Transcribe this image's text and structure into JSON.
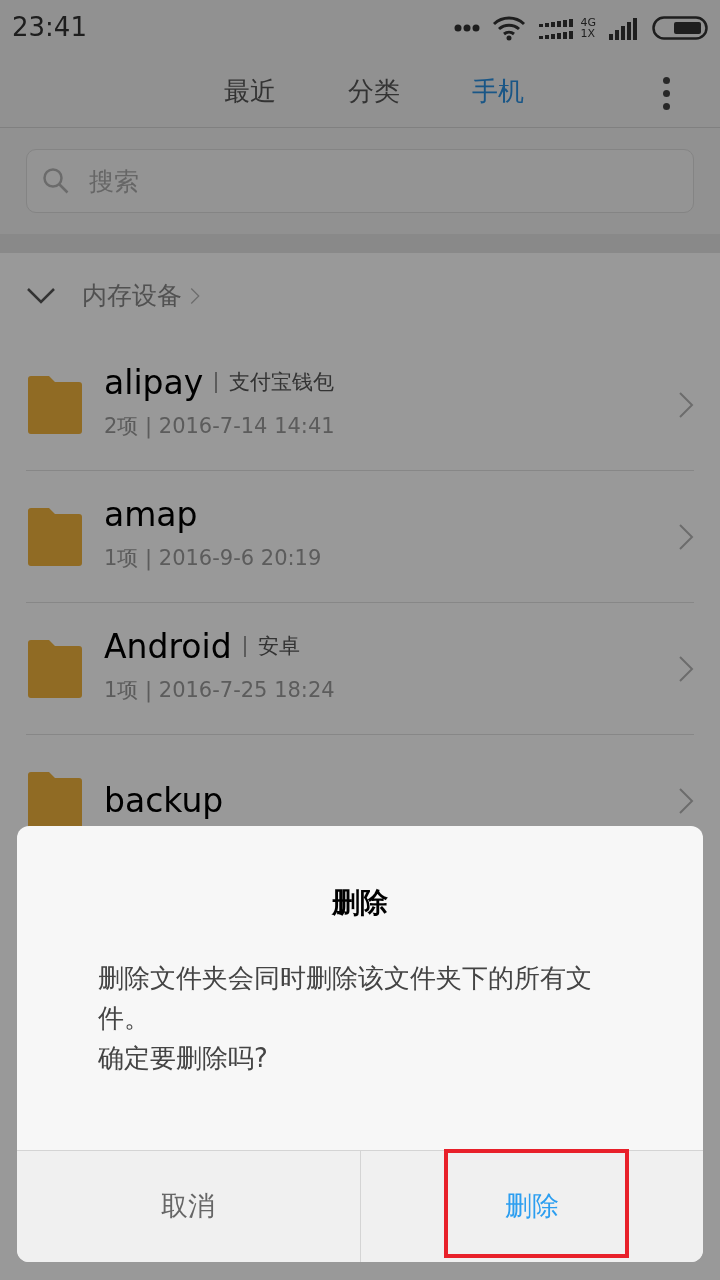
{
  "status_bar": {
    "time": "23:41",
    "network_label_top": "4G",
    "network_label_bottom": "1X"
  },
  "tabs": [
    {
      "label": "最近",
      "selected": false
    },
    {
      "label": "分类",
      "selected": false
    },
    {
      "label": "手机",
      "selected": true
    }
  ],
  "search": {
    "placeholder": "搜索"
  },
  "breadcrumb": {
    "label": "内存设备",
    "expanded": true
  },
  "folders": [
    {
      "name": "alipay",
      "tag": "支付宝钱包",
      "meta": "2项 | 2016-7-14 14:41"
    },
    {
      "name": "amap",
      "meta": "1项 | 2016-9-6 20:19"
    },
    {
      "name": "Android",
      "tag": "安卓",
      "meta": "1项 | 2016-7-25 18:24"
    },
    {
      "name": "backup"
    }
  ],
  "dialog": {
    "title": "删除",
    "message": "删除文件夹会同时删除该文件夹下的所有文件。",
    "question": "确定要删除吗?",
    "buttons": [
      {
        "label": "取消",
        "kind": "cancel",
        "highlighted": false
      },
      {
        "label": "删除",
        "kind": "confirm",
        "highlighted": true
      }
    ]
  }
}
